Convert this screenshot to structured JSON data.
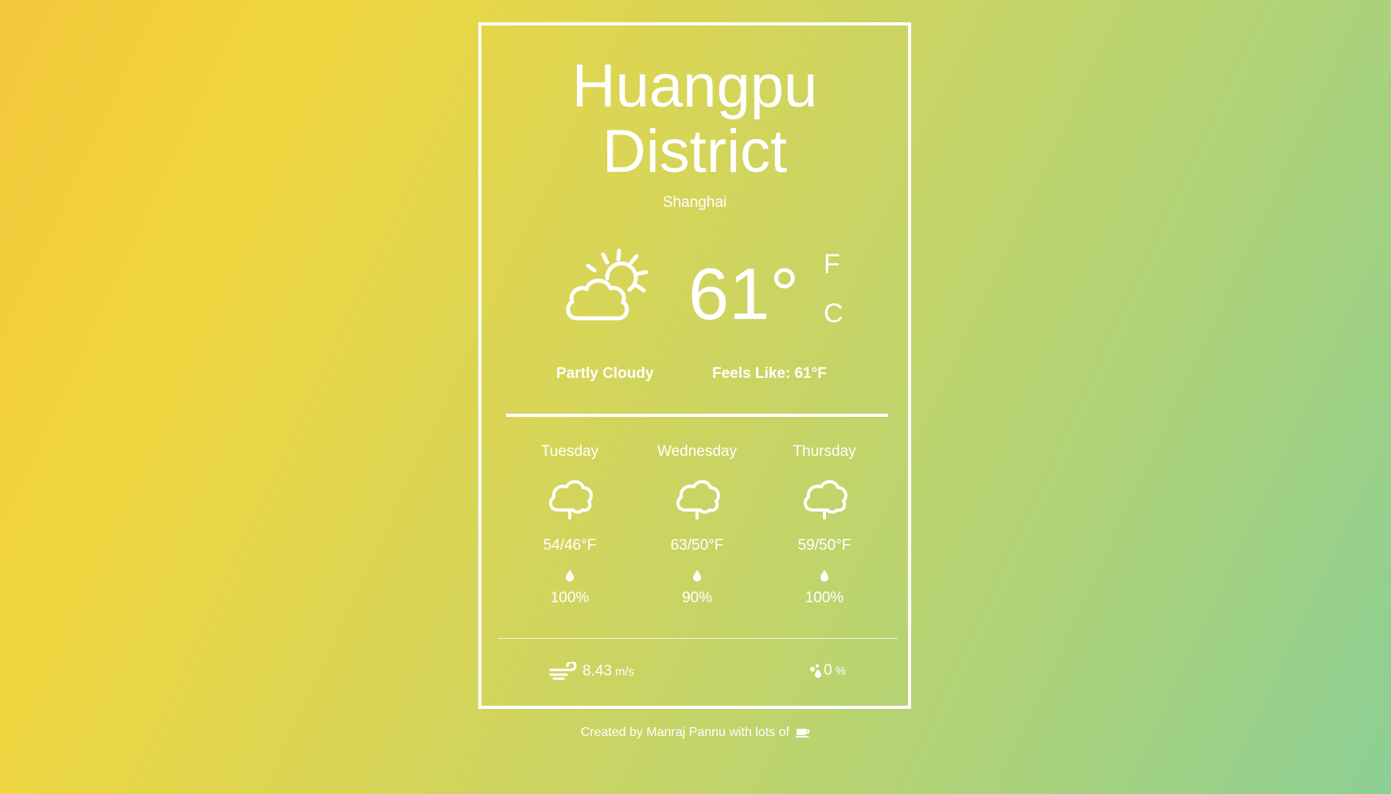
{
  "location": {
    "city_line1": "Huangpu",
    "city_line2": "District",
    "region": "Shanghai"
  },
  "current": {
    "icon": "partly-cloudy-icon",
    "temperature": "61°",
    "unit_f": "F",
    "unit_c": "C",
    "condition": "Partly Cloudy",
    "feels_like": "Feels Like: 61°F"
  },
  "forecast": [
    {
      "day": "Tuesday",
      "icon": "rain-cloud-icon",
      "range": "54/46°F",
      "precip": "100%"
    },
    {
      "day": "Wednesday",
      "icon": "rain-cloud-icon",
      "range": "63/50°F",
      "precip": "90%"
    },
    {
      "day": "Thursday",
      "icon": "rain-cloud-icon",
      "range": "59/50°F",
      "precip": "100%"
    }
  ],
  "details": {
    "wind_value": "8.43",
    "wind_unit": "m/s",
    "humidity_value": "0",
    "humidity_unit": "%"
  },
  "footer": {
    "text": "Created by Manraj Pannu with lots of"
  },
  "colors": {
    "gradient_start": "#f3c73a",
    "gradient_end": "#8ccf94",
    "foreground": "#ffffff"
  }
}
